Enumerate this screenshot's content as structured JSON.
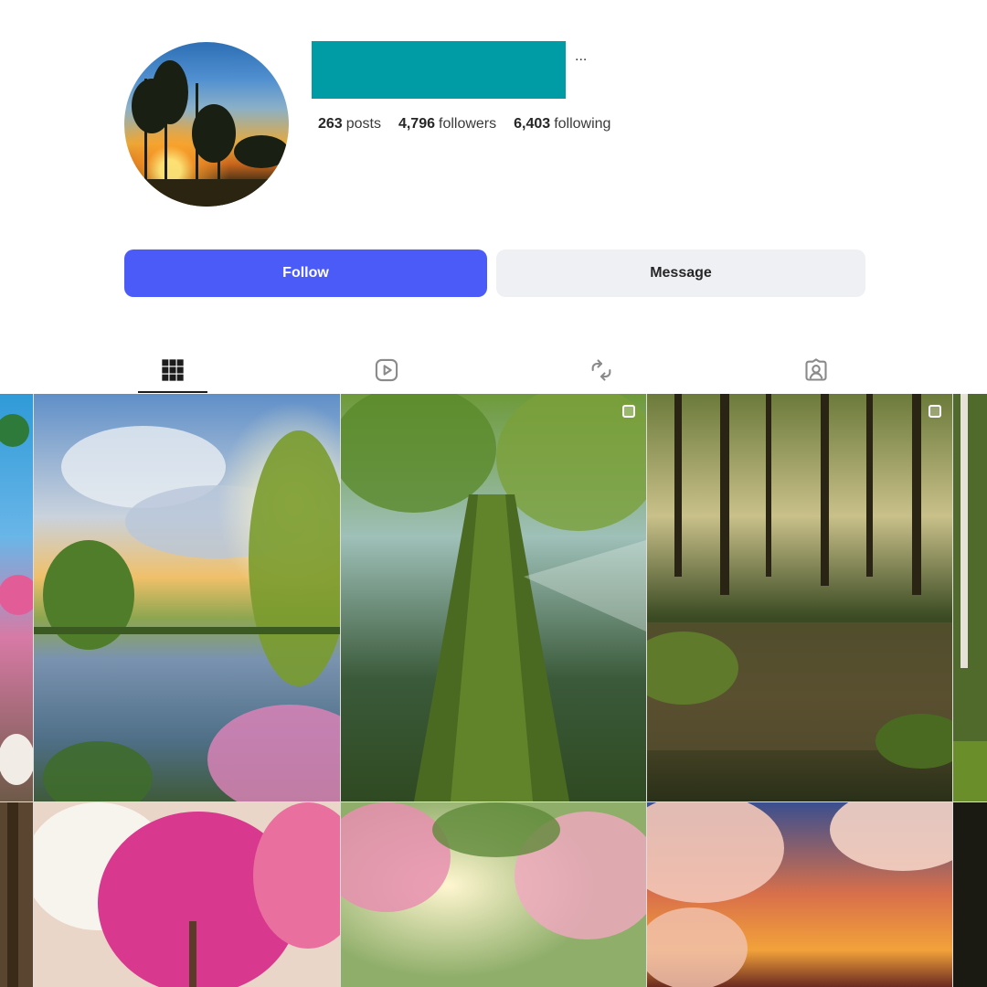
{
  "profile": {
    "more_label": "...",
    "stats": {
      "posts_count": "263",
      "posts_label": "posts",
      "followers_count": "4,796",
      "followers_label": "followers",
      "following_count": "6,403",
      "following_label": "following"
    }
  },
  "actions": {
    "follow_label": "Follow",
    "message_label": "Message"
  },
  "tabs": [
    {
      "icon": "grid-icon",
      "active": true
    },
    {
      "icon": "reels-icon",
      "active": false
    },
    {
      "icon": "repost-icon",
      "active": false
    },
    {
      "icon": "tagged-icon",
      "active": false
    }
  ],
  "colors": {
    "follow_button": "#4a5bf8",
    "message_button": "#eff0f4",
    "username_redaction": "#009ca6"
  }
}
